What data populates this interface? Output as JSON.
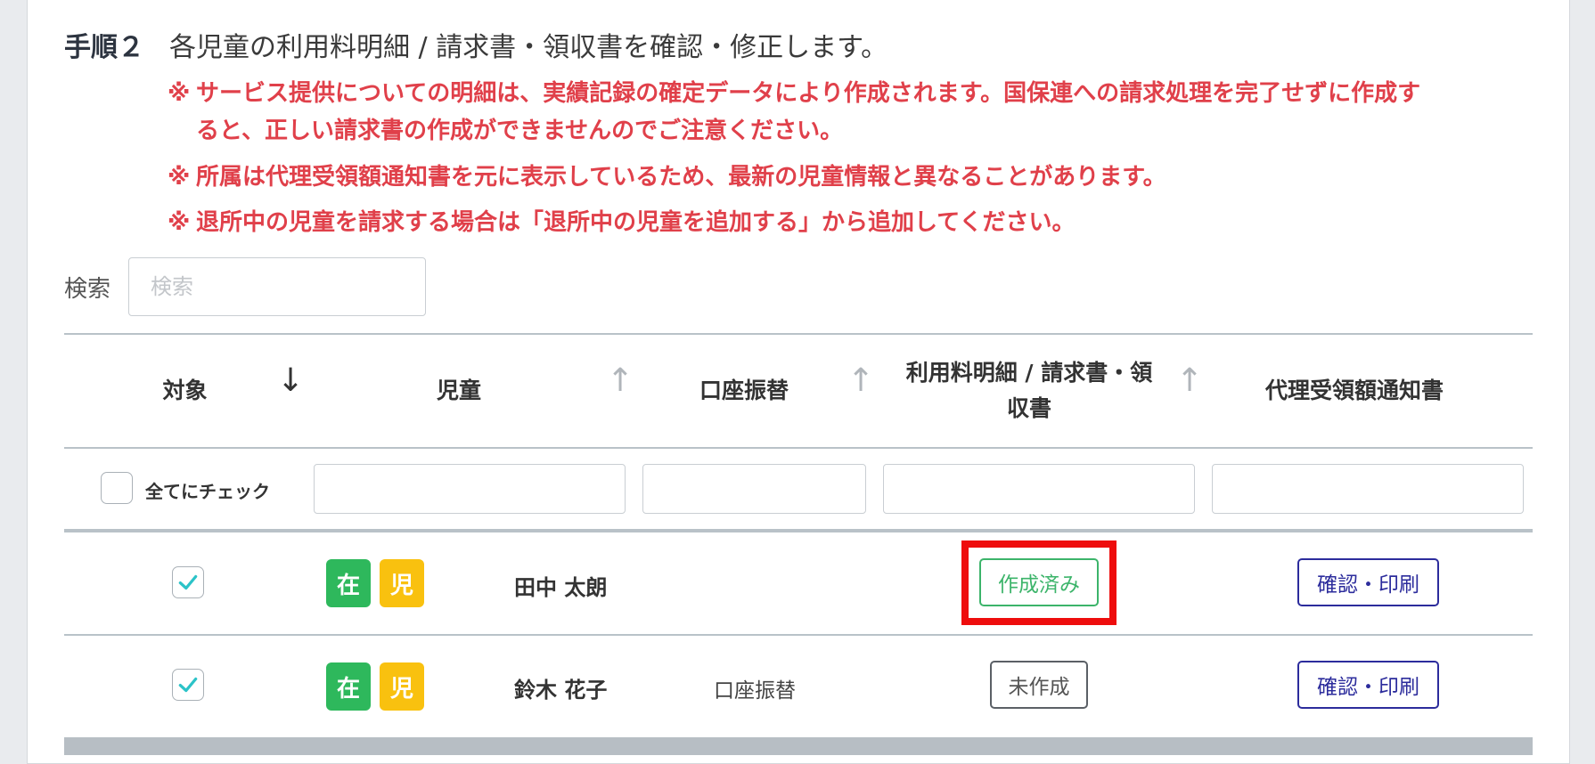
{
  "step": {
    "number": "手順２",
    "title": "各児童の利用料明細 / 請求書・領収書を確認・修正します。"
  },
  "notes": [
    {
      "mark": "※",
      "lines": [
        "サービス提供についての明細は、実績記録の確定データにより作成されます。国保連への請求処理を完了せずに作成す",
        "ると、正しい請求書の作成ができませんのでご注意ください。"
      ]
    },
    {
      "mark": "※",
      "lines": [
        "所属は代理受領額通知書を元に表示しているため、最新の児童情報と異なることがあります。"
      ]
    },
    {
      "mark": "※",
      "lines": [
        "退所中の児童を請求する場合は「退所中の児童を追加する」から追加してください。"
      ]
    }
  ],
  "search": {
    "label": "検索",
    "placeholder": "検索",
    "value": ""
  },
  "table": {
    "headers": {
      "target": "対象",
      "child": "児童",
      "transfer": "口座振替",
      "statement": [
        "利用料明細 / 請求書・領",
        "収書"
      ],
      "notice": "代理受領額通知書"
    },
    "sort_icons": {
      "target": "arrow-down-icon",
      "others": "arrow-up-icon"
    },
    "check_all_label": "全てにチェック",
    "rows": [
      {
        "checked": true,
        "badge_status": "在",
        "badge_type": "児",
        "name": "田中 太朗",
        "transfer": "",
        "statement_button": "作成済み",
        "statement_state": "done",
        "notice_button": "確認・印刷"
      },
      {
        "checked": true,
        "badge_status": "在",
        "badge_type": "児",
        "name": "鈴木 花子",
        "transfer": "口座振替",
        "statement_button": "未作成",
        "statement_state": "none",
        "notice_button": "確認・印刷"
      }
    ]
  },
  "colors": {
    "note_red": "#e0404a",
    "badge_green": "#2eb85c",
    "badge_yellow": "#f9c10f",
    "done_green": "#3cb46a",
    "print_navy": "#2c2c9c",
    "highlight_red": "#ee0d0d",
    "check_teal": "#2bc3c8"
  }
}
